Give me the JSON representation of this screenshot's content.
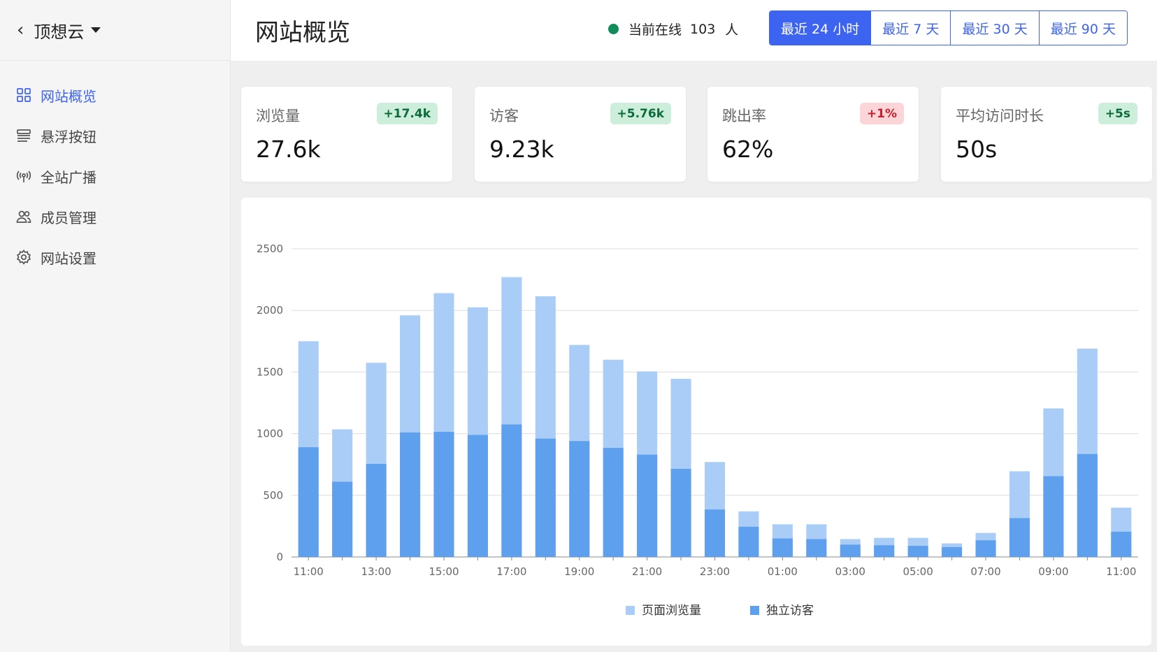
{
  "sidebar": {
    "app_name": "顶想云",
    "items": [
      {
        "label": "网站概览",
        "icon": "grid-icon",
        "active": true
      },
      {
        "label": "悬浮按钮",
        "icon": "layers-icon",
        "active": false
      },
      {
        "label": "全站广播",
        "icon": "broadcast-icon",
        "active": false
      },
      {
        "label": "成员管理",
        "icon": "users-icon",
        "active": false
      },
      {
        "label": "网站设置",
        "icon": "gear-icon",
        "active": false
      }
    ]
  },
  "header": {
    "title": "网站概览",
    "online_label": "当前在线",
    "online_count": "103",
    "online_unit": "人",
    "ranges": [
      {
        "label": "最近 24 小时",
        "active": true
      },
      {
        "label": "最近 7 天",
        "active": false
      },
      {
        "label": "最近 30 天",
        "active": false
      },
      {
        "label": "最近 90 天",
        "active": false
      }
    ]
  },
  "stats": [
    {
      "label": "浏览量",
      "value": "27.6k",
      "delta": "+17.4k",
      "trend": "up"
    },
    {
      "label": "访客",
      "value": "9.23k",
      "delta": "+5.76k",
      "trend": "up"
    },
    {
      "label": "跳出率",
      "value": "62%",
      "delta": "+1%",
      "trend": "bad"
    },
    {
      "label": "平均访问时长",
      "value": "50s",
      "delta": "+5s",
      "trend": "up"
    }
  ],
  "colors": {
    "accent": "#3d63f1",
    "pageviews": "#aacdf7",
    "visitors": "#5ea0ee",
    "online_dot": "#0e8c5a"
  },
  "chart_data": {
    "type": "bar",
    "stacked": "overlay",
    "categories": [
      "11:00",
      "12:00",
      "13:00",
      "14:00",
      "15:00",
      "16:00",
      "17:00",
      "18:00",
      "19:00",
      "20:00",
      "21:00",
      "22:00",
      "23:00",
      "00:00",
      "01:00",
      "02:00",
      "03:00",
      "04:00",
      "05:00",
      "06:00",
      "07:00",
      "08:00",
      "09:00",
      "10:00",
      "11:00"
    ],
    "x_tick_labels": [
      "11:00",
      "13:00",
      "15:00",
      "17:00",
      "19:00",
      "21:00",
      "23:00",
      "01:00",
      "03:00",
      "05:00",
      "07:00",
      "09:00",
      "11:00"
    ],
    "series": [
      {
        "name": "页面浏览量",
        "color": "#aacdf7",
        "values": [
          1750,
          1035,
          1575,
          1960,
          2140,
          2025,
          2270,
          2115,
          1720,
          1600,
          1505,
          1445,
          770,
          370,
          265,
          265,
          145,
          155,
          155,
          110,
          195,
          695,
          1205,
          1690,
          400
        ]
      },
      {
        "name": "独立访客",
        "color": "#5ea0ee",
        "values": [
          890,
          610,
          755,
          1010,
          1015,
          990,
          1075,
          960,
          940,
          885,
          830,
          715,
          385,
          245,
          150,
          145,
          100,
          95,
          90,
          80,
          135,
          315,
          655,
          835,
          205
        ]
      }
    ],
    "y_ticks": [
      0,
      500,
      1000,
      1500,
      2000,
      2500
    ],
    "ylim": [
      0,
      2500
    ],
    "grid": true,
    "legend_position": "bottom-center"
  }
}
